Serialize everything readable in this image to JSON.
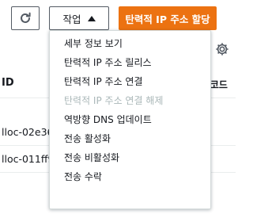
{
  "toolbar": {
    "refresh_icon": "refresh-icon",
    "actions_label": "작업",
    "actions_caret_icon": "caret-up-icon",
    "primary_label": "탄력적 IP 주소 할당",
    "primary_color": "#ec7211"
  },
  "pagination": {
    "next_icon": "chevron-right-icon"
  },
  "settings": {
    "icon": "gear-icon"
  },
  "table": {
    "columns": [
      {
        "label": "ID"
      },
      {
        "label": "DNS 레코드"
      }
    ],
    "rows": [
      {
        "id_text": "lloc-02e36"
      },
      {
        "id_text": "lloc-011ff9"
      }
    ]
  },
  "menu": {
    "items": [
      {
        "label": "세부 정보 보기",
        "disabled": false
      },
      {
        "label": "탄력적 IP 주소 릴리스",
        "disabled": false
      },
      {
        "label": "탄력적 IP 주소 연결",
        "disabled": false
      },
      {
        "label": "탄력적 IP 주소 연결 해제",
        "disabled": true
      },
      {
        "label": "역방향 DNS 업데이트",
        "disabled": false
      },
      {
        "label": "전송 활성화",
        "disabled": false
      },
      {
        "label": "전송 비활성화",
        "disabled": false
      },
      {
        "label": "전송 수락",
        "disabled": false
      }
    ]
  }
}
